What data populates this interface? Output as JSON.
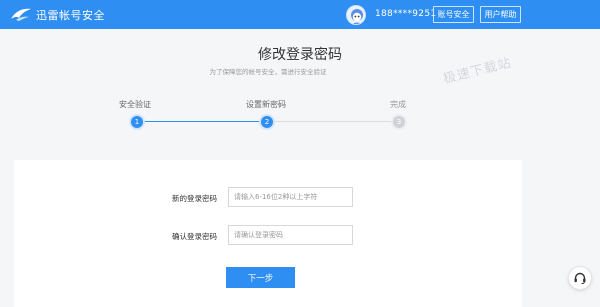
{
  "header": {
    "brand_name": "迅雷帐号安全",
    "brand_icon": "xunlei-bird-logo",
    "avatar_icon": "user-avatar",
    "phone": "188****9251",
    "security_label": "账号安全",
    "help_label": "用户帮助"
  },
  "page": {
    "title": "修改登录密码",
    "subtitle": "为了保障您的帐号安全，需进行安全验证",
    "watermark": "极速下载站"
  },
  "steps": [
    {
      "label": "安全验证",
      "number": "1",
      "state": "done"
    },
    {
      "label": "设置新密码",
      "number": "2",
      "state": "current"
    },
    {
      "label": "完成",
      "number": "3",
      "state": "pending"
    }
  ],
  "form": {
    "new_password_label": "新的登录密码",
    "new_password_placeholder": "请输入6-16位2种以上字符",
    "confirm_password_label": "确认登录密码",
    "confirm_password_placeholder": "请确认登录密码",
    "next_label": "下一步"
  },
  "support": {
    "icon": "headset-support-icon"
  },
  "colors": {
    "primary": "#2f8ef1",
    "background": "#f5f6f8",
    "inactive_step": "#cfd3d8"
  }
}
